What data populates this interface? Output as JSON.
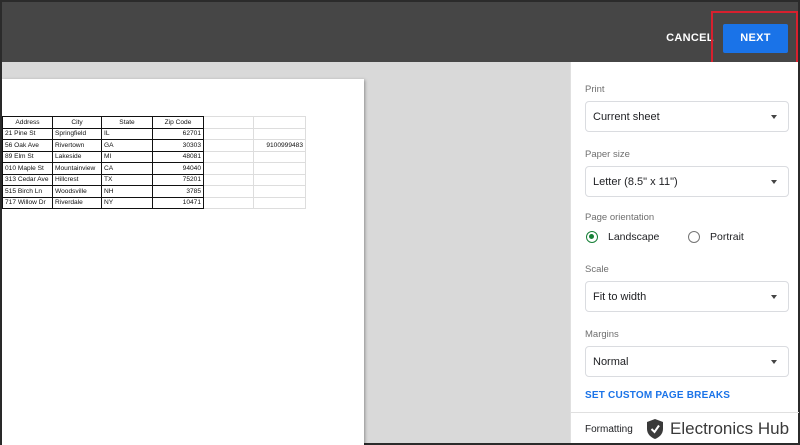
{
  "topbar": {
    "cancel_label": "CANCEL",
    "next_label": "NEXT"
  },
  "spreadsheet": {
    "headers": [
      "Address",
      "City",
      "State",
      "Zip Code",
      "",
      ""
    ],
    "rows": [
      [
        "21 Pine St",
        "Springfield",
        "IL",
        "62701",
        "",
        ""
      ],
      [
        "56 Oak Ave",
        "Rivertown",
        "GA",
        "30303",
        "",
        "9100999483"
      ],
      [
        "89 Elm St",
        "Lakeside",
        "MI",
        "48081",
        "",
        ""
      ],
      [
        "010 Maple St",
        "Mountainview",
        "CA",
        "94040",
        "",
        ""
      ],
      [
        "313 Cedar Ave",
        "Hillcrest",
        "TX",
        "75201",
        "",
        ""
      ],
      [
        "515 Birch Ln",
        "Woodsville",
        "NH",
        "3785",
        "",
        ""
      ],
      [
        "717 Willow Dr",
        "Riverdale",
        "NY",
        "10471",
        "",
        ""
      ]
    ]
  },
  "settings": {
    "print_label": "Print",
    "print_value": "Current sheet",
    "paper_size_label": "Paper size",
    "paper_size_value": "Letter (8.5\" x 11\")",
    "orientation_label": "Page orientation",
    "orientation_options": [
      "Landscape",
      "Portrait"
    ],
    "orientation_selected": "Landscape",
    "scale_label": "Scale",
    "scale_value": "Fit to width",
    "margins_label": "Margins",
    "margins_value": "Normal",
    "custom_breaks_label": "SET CUSTOM PAGE BREAKS",
    "formatting_label": "Formatting"
  },
  "watermark": {
    "brand": "Electronics Hub"
  },
  "colors": {
    "accent_blue": "#1a73e8",
    "radio_green": "#188038",
    "highlight_red": "#d8202e",
    "topbar": "#464646"
  }
}
